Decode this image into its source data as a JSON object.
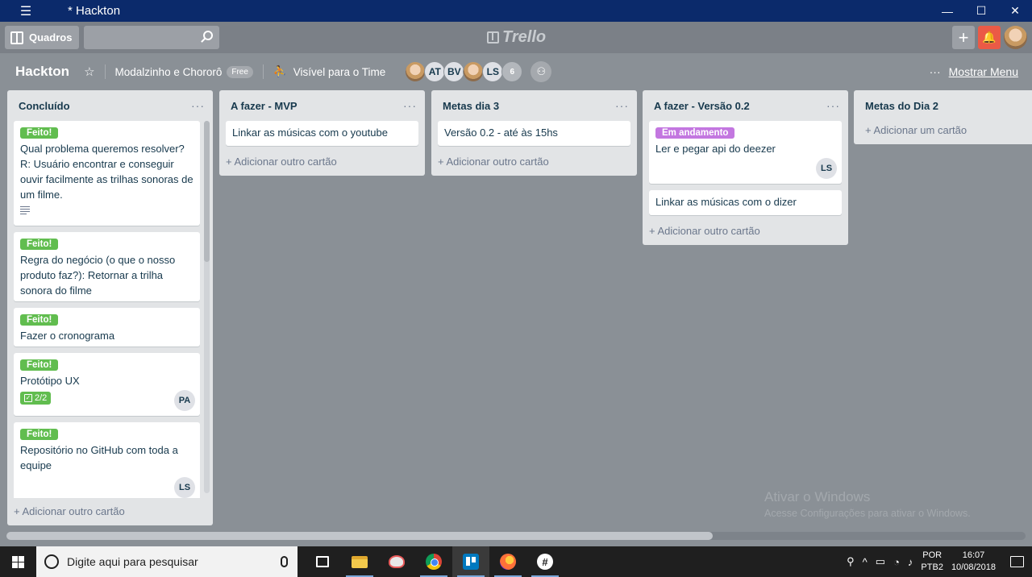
{
  "window": {
    "title": "* Hackton",
    "minimize": "—",
    "maximize": "☐",
    "close": "✕"
  },
  "header": {
    "boards_label": "Quadros",
    "search_value": "",
    "logo_text": "Trello",
    "add_label": "+",
    "notif_label": "🔔"
  },
  "board": {
    "name": "Hackton",
    "team": "Modalzinho e Chororô",
    "team_badge": "Free",
    "visibility": "Visível para o Time",
    "members": [
      "AT",
      "BV",
      "LS"
    ],
    "members_extra": "6",
    "menu_label": "Mostrar Menu",
    "menu_dots": "···"
  },
  "lists": [
    {
      "title": "Concluído",
      "add": "+ Adicionar outro cartão",
      "cards": [
        {
          "label": "Feito!",
          "text": "Qual problema queremos resolver? R: Usuário encontrar e conseguir ouvir facilmente as trilhas sonoras de um filme."
        },
        {
          "label": "Feito!",
          "text": "Regra do negócio (o que o nosso produto faz?): Retornar a trilha sonora do filme"
        },
        {
          "label": "Feito!",
          "text": "Fazer o cronograma"
        },
        {
          "label": "Feito!",
          "text": "Protótipo UX",
          "checklist": "2/2",
          "member": "PA"
        },
        {
          "label": "Feito!",
          "text": "Repositório no GitHub com toda a equipe",
          "member": "LS"
        }
      ]
    },
    {
      "title": "A fazer - MVP",
      "add": "+ Adicionar outro cartão",
      "cards": [
        {
          "text": "Linkar as músicas com o youtube"
        }
      ]
    },
    {
      "title": "Metas dia 3",
      "add": "+ Adicionar outro cartão",
      "cards": [
        {
          "text": "Versão 0.2 - até às 15hs"
        }
      ]
    },
    {
      "title": "A fazer - Versão 0.2",
      "add": "+ Adicionar outro cartão",
      "cards": [
        {
          "label": "Em andamento",
          "text": "Ler e pegar api do deezer",
          "member": "LS"
        },
        {
          "text": "Linkar as músicas com o dizer"
        }
      ]
    },
    {
      "title": "Metas do Dia 2",
      "add": "+ Adicionar um cartão",
      "cards": []
    }
  ],
  "list_menu": "···",
  "watermark": {
    "line1": "Ativar o Windows",
    "line2": "Acesse Configurações para ativar o Windows."
  },
  "taskbar": {
    "search_placeholder": "Digite aqui para pesquisar",
    "lang": "POR",
    "layout": "PTB2",
    "time": "16:07",
    "date": "10/08/2018"
  },
  "colors": {
    "label_done": "#61bd4f",
    "label_in_progress": "#c377e0",
    "notification": "#eb5a46",
    "titlebar": "#0b2a6b"
  }
}
